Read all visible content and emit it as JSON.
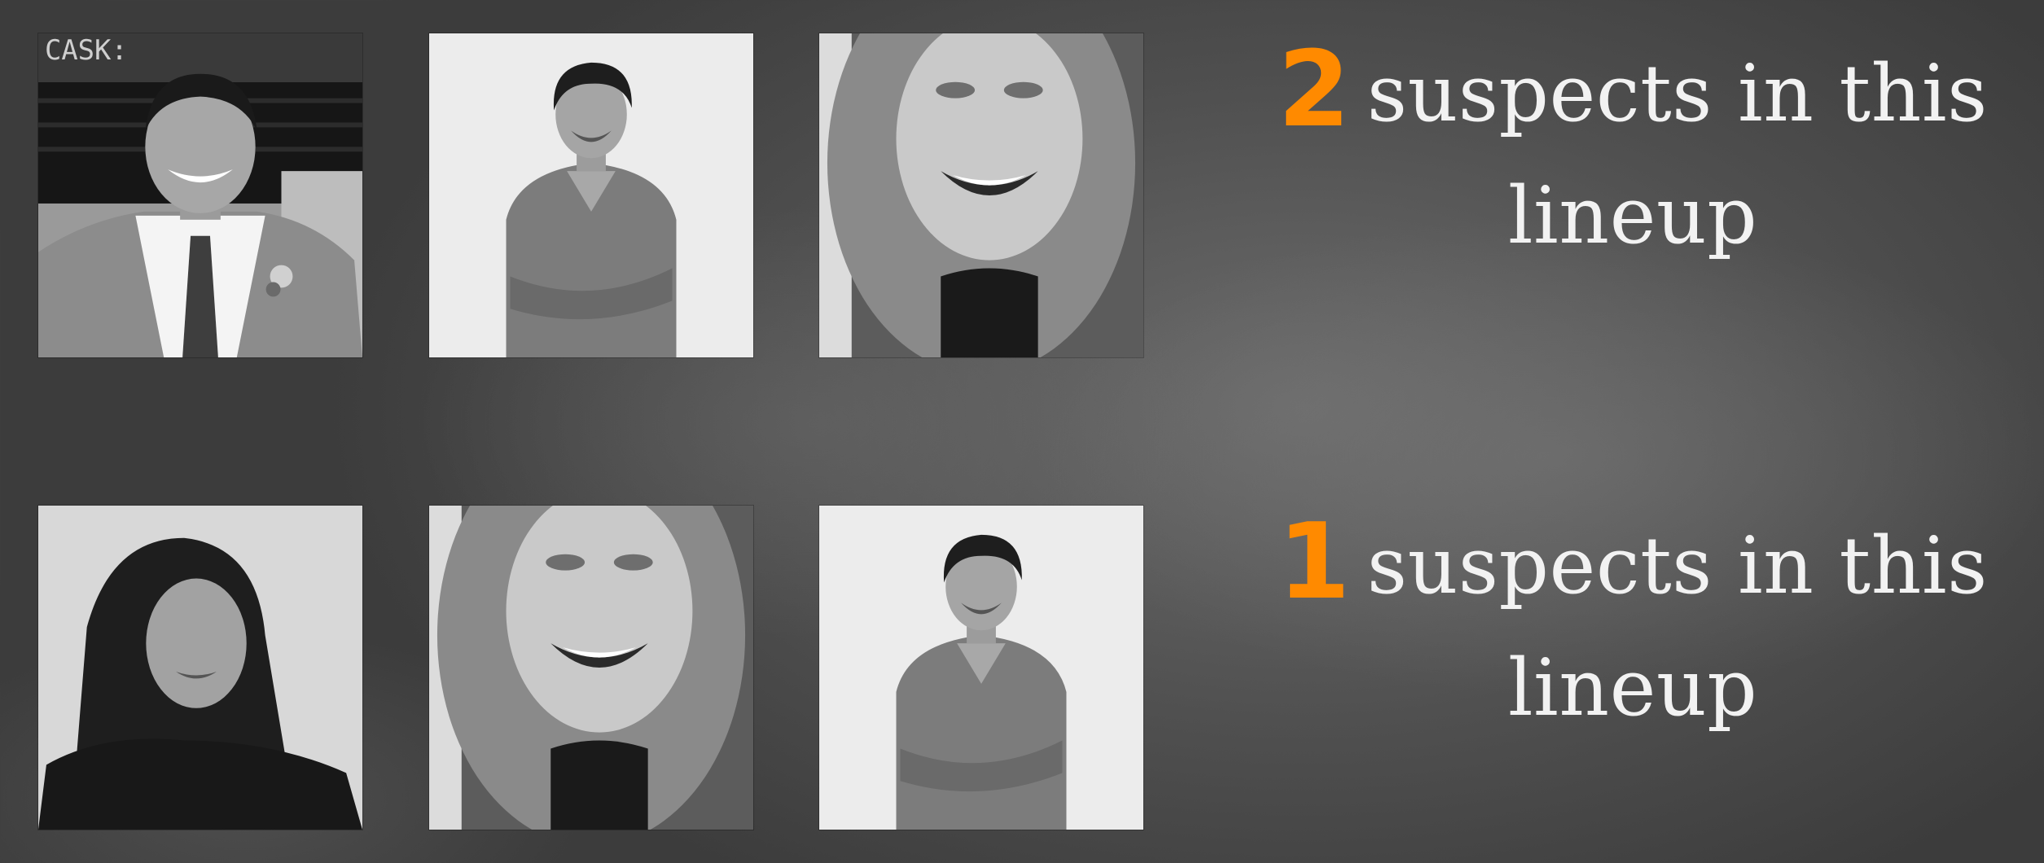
{
  "colors": {
    "accent": "#ff8a00",
    "text": "#f2f2f2"
  },
  "lineups": [
    {
      "count": "2",
      "line1": "suspects in this",
      "line2": "lineup",
      "photos": [
        {
          "subject": "smiling man in suit and tie with boutonniere"
        },
        {
          "subject": "man in v-neck sweater with crossed arms"
        },
        {
          "subject": "smiling woman with curly hair"
        }
      ]
    },
    {
      "count": "1",
      "line1": "suspects in this",
      "line2": "lineup",
      "photos": [
        {
          "subject": "woman with long dark hair"
        },
        {
          "subject": "smiling woman with curly hair"
        },
        {
          "subject": "man in v-neck sweater with crossed arms"
        }
      ]
    }
  ]
}
